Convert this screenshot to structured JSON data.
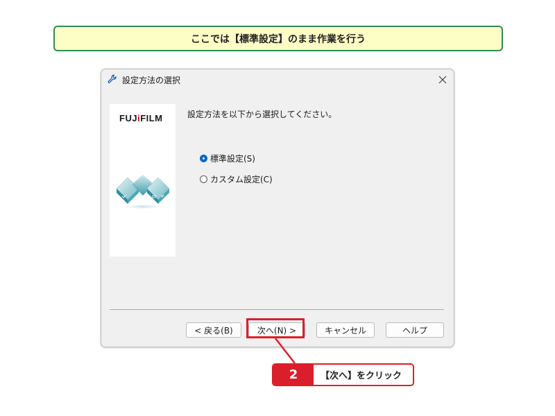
{
  "banner": {
    "text": "ここでは【標準設定】のまま作業を行う"
  },
  "dialog": {
    "title": "設定方法の選択",
    "brand": {
      "pre": "FUJ",
      "dot": "i",
      "post": "FILM"
    },
    "instruction": "設定方法を以下から選択してください。",
    "options": [
      {
        "label": "標準設定(S)",
        "selected": true
      },
      {
        "label": "カスタム設定(C)",
        "selected": false
      }
    ],
    "buttons": {
      "back": "< 戻る(B)",
      "next": "次へ(N) >",
      "cancel": "キャンセル",
      "help": "ヘルプ"
    }
  },
  "callout": {
    "step": "2",
    "text": "【次へ】をクリック"
  },
  "colors": {
    "accent_red": "#d91f2b",
    "banner_border": "#2e8b57",
    "banner_bg": "#fdfdc6",
    "radio_blue": "#0067c0"
  },
  "icons": {
    "title": "wrench-icon",
    "close": "close-icon",
    "logo": "infinity-logo-icon"
  }
}
